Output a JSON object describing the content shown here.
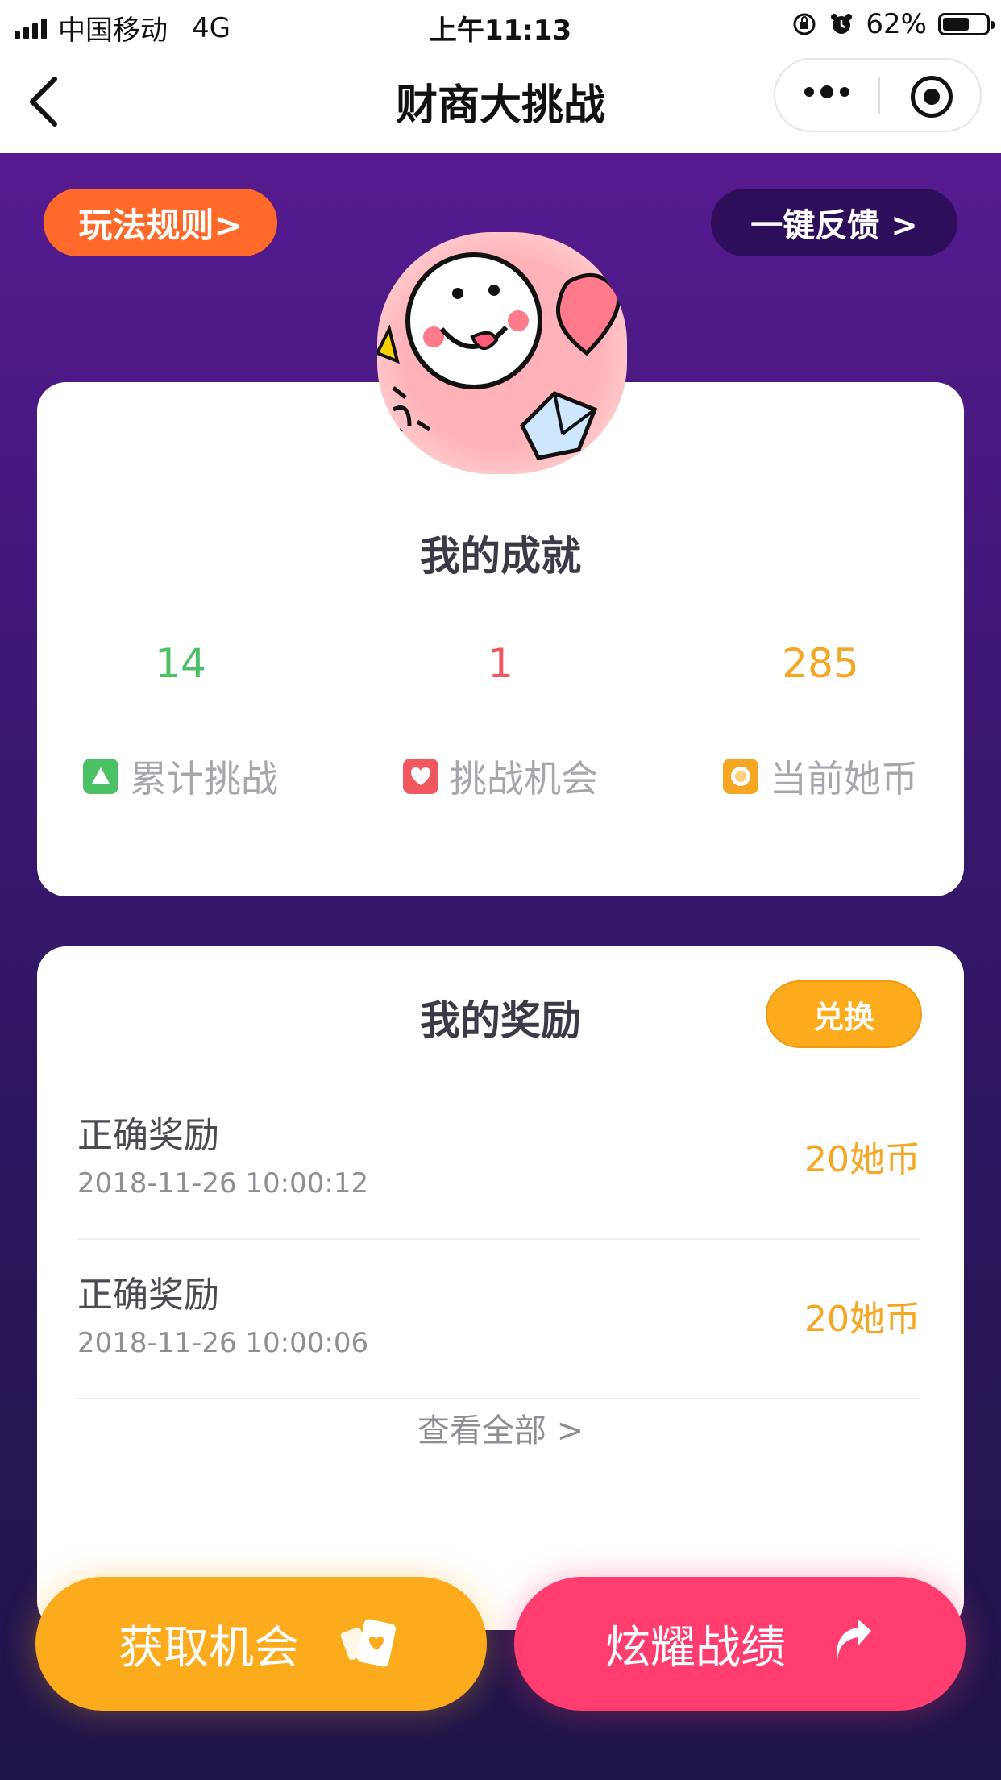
{
  "status_bar": {
    "carrier": "中国移动",
    "network": "4G",
    "time": "上午11:13",
    "battery_percent": "62%",
    "battery_level": 0.62
  },
  "nav": {
    "title": "财商大挑战",
    "back_icon": "chevron-left-icon",
    "more_icon": "more-dots-icon",
    "close_icon": "target-close-icon"
  },
  "top_buttons": {
    "rules": "玩法规则>",
    "feedback": "一键反馈 >"
  },
  "achievements": {
    "title": "我的成就",
    "stats": [
      {
        "value": "14",
        "label": "累计挑战",
        "color": "#4cc064",
        "icon": "triangle-icon"
      },
      {
        "value": "1",
        "label": "挑战机会",
        "color": "#f0575e",
        "icon": "heart-icon"
      },
      {
        "value": "285",
        "label": "当前她币",
        "color": "#f5a623",
        "icon": "coin-icon"
      }
    ]
  },
  "rewards": {
    "title": "我的奖励",
    "exchange": "兑换",
    "items": [
      {
        "name": "正确奖励",
        "time": "2018-11-26 10:00:12",
        "amount": "20她币"
      },
      {
        "name": "正确奖励",
        "time": "2018-11-26 10:00:06",
        "amount": "20她币"
      }
    ],
    "view_all": "查看全部 >"
  },
  "actions": {
    "get_chance": "获取机会",
    "show_off": "炫耀战绩"
  },
  "colors": {
    "orange": "#fcab1c",
    "pink": "#ff3d6e",
    "purple": "#561a90",
    "rules_orange": "#ff6a2a"
  }
}
